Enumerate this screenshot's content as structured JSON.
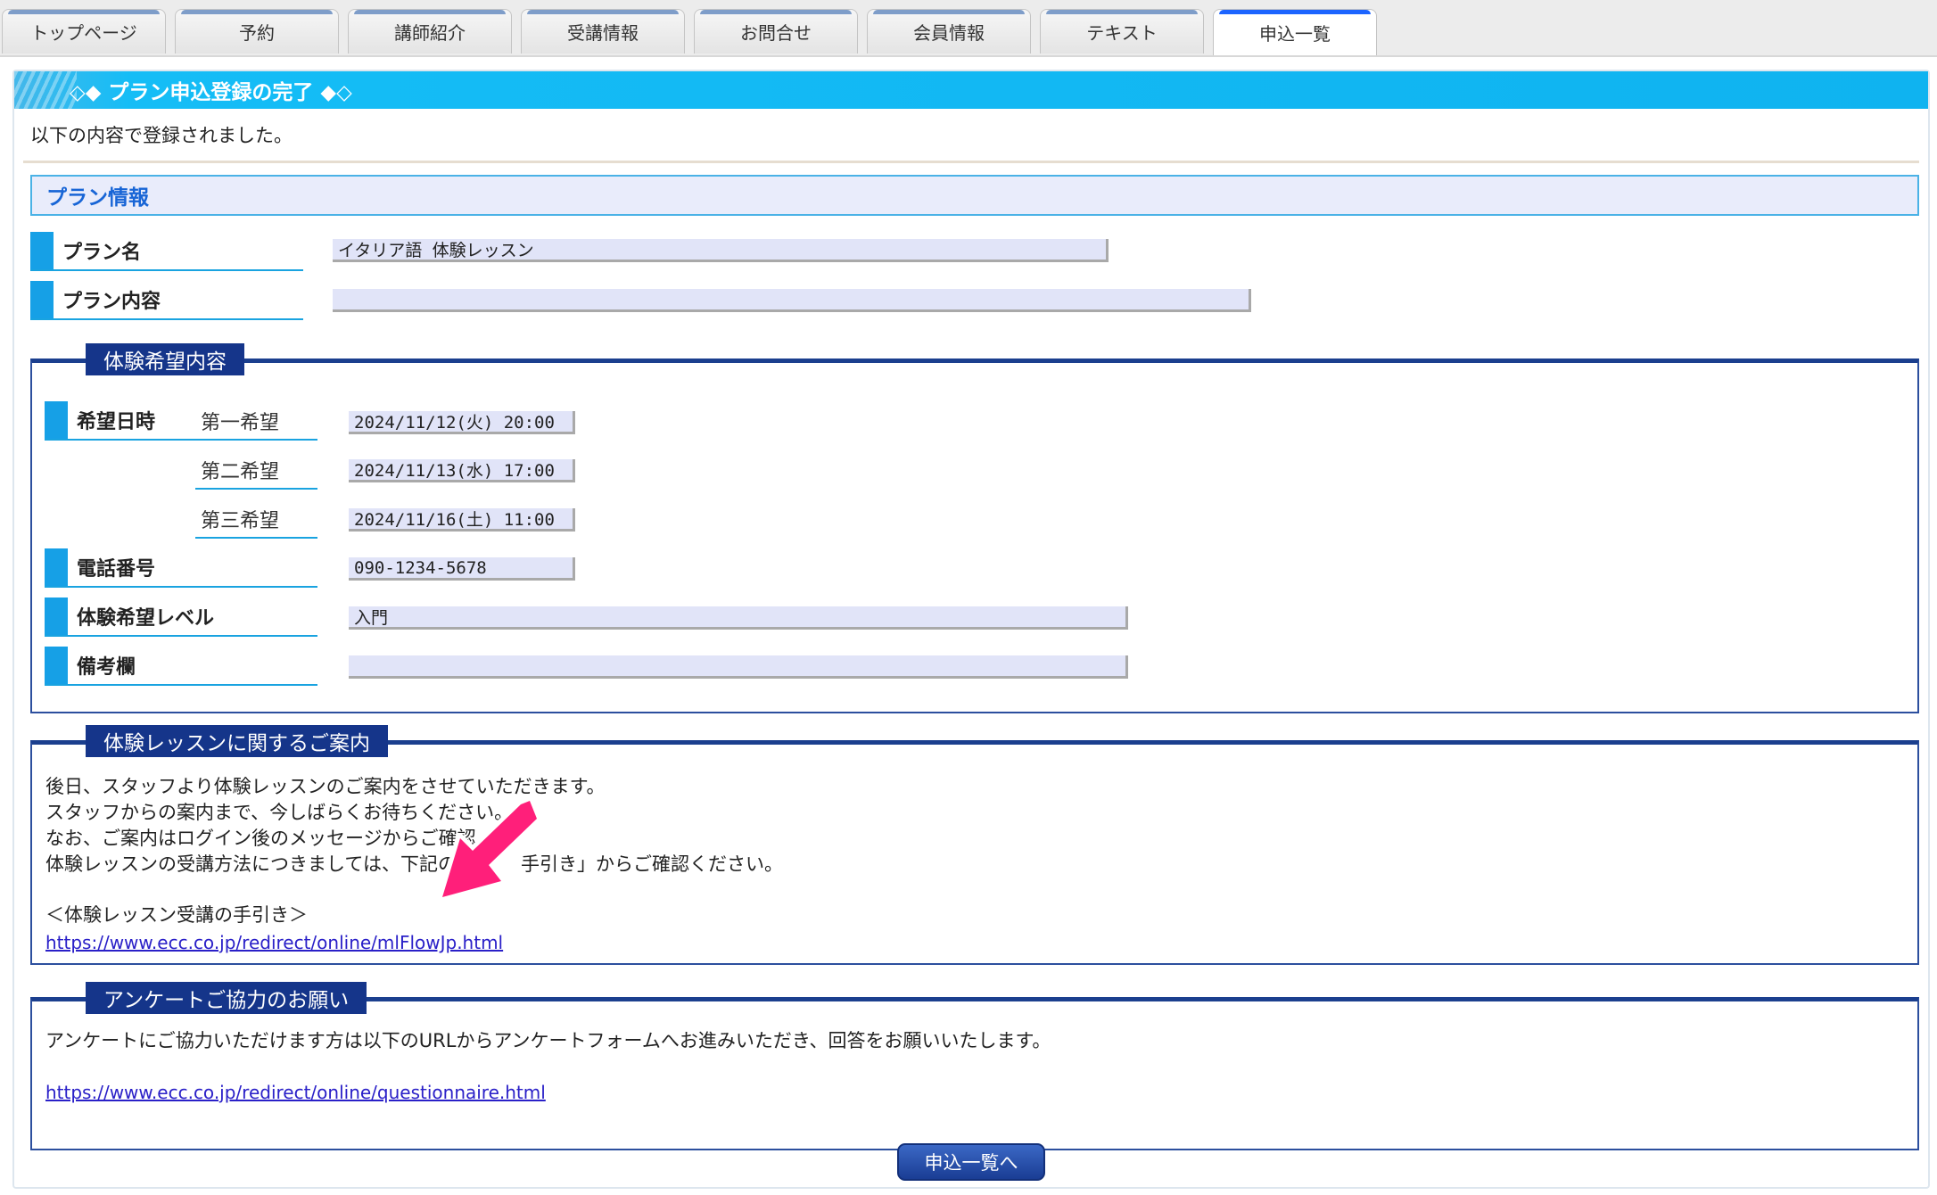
{
  "tabs": [
    {
      "label": "トップページ"
    },
    {
      "label": "予約"
    },
    {
      "label": "講師紹介"
    },
    {
      "label": "受講情報"
    },
    {
      "label": "お問合せ"
    },
    {
      "label": "会員情報"
    },
    {
      "label": "テキスト"
    },
    {
      "label": "申込一覧",
      "active": true
    }
  ],
  "title": "◇◆ プラン申込登録の完了 ◆◇",
  "lead": "以下の内容で登録されました。",
  "plan_info": {
    "header": "プラン情報",
    "name_label": "プラン名",
    "name_value": "イタリア語 体験レッスン",
    "content_label": "プラン内容",
    "content_value": ""
  },
  "trial": {
    "legend": "体験希望内容",
    "date_label": "希望日時",
    "choice1_label": "第一希望",
    "choice1_value": "2024/11/12(火) 20:00",
    "choice2_label": "第二希望",
    "choice2_value": "2024/11/13(水) 17:00",
    "choice3_label": "第三希望",
    "choice3_value": "2024/11/16(土) 11:00",
    "phone_label": "電話番号",
    "phone_value": "090-1234-5678",
    "level_label": "体験希望レベル",
    "level_value": "入門",
    "notes_label": "備考欄",
    "notes_value": ""
  },
  "guide": {
    "legend": "体験レッスンに関するご案内",
    "line1": "後日、スタッフより体験レッスンのご案内をさせていただきます。",
    "line2": "スタッフからの案内まで、今しばらくお待ちください。",
    "line3": "なお、ご案内はログイン後のメッセージからご確認",
    "line4a": "体験レッスンの受講方法につきましては、下記の",
    "line4b": "手引き」からご確認ください。",
    "heading": "＜体験レッスン受講の手引き＞",
    "link": "https://www.ecc.co.jp/redirect/online/mlFlowJp.html"
  },
  "survey": {
    "legend": "アンケートご協力のお願い",
    "text": "アンケートにご協力いただけます方は以下のURLからアンケートフォームへお進みいただき、回答をお願いいたします。",
    "link": "https://www.ecc.co.jp/redirect/online/questionnaire.html"
  },
  "button_label": "申込一覧へ",
  "colors": {
    "accent": "#15bdf6",
    "legend_bg": "#15358a",
    "annotation_arrow": "#ff1f7a"
  },
  "icons": [
    "annotation-arrow-icon"
  ]
}
